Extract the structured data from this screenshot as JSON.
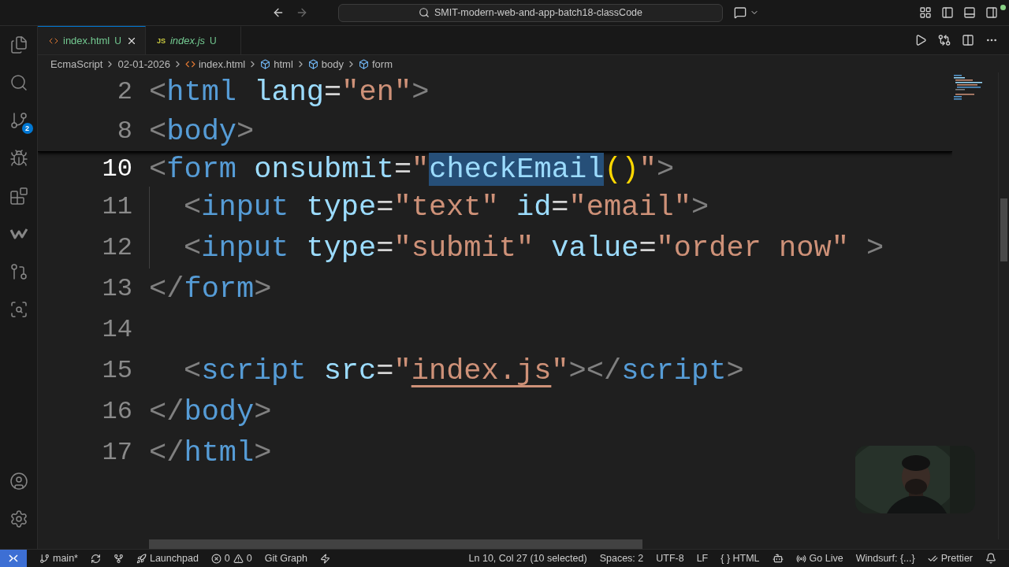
{
  "title_bar": {
    "search": "SMIT-modern-web-and-app-batch18-classCode"
  },
  "activity_bar": {
    "items": [
      {
        "kind": "explorer",
        "selected": false
      },
      {
        "kind": "search",
        "selected": false
      },
      {
        "kind": "source-control",
        "selected": false,
        "badge": "2"
      },
      {
        "kind": "run-debug",
        "selected": false
      },
      {
        "kind": "extensions",
        "selected": false
      },
      {
        "kind": "windsurf",
        "selected": false
      },
      {
        "kind": "git-graph",
        "selected": false
      },
      {
        "kind": "inspect",
        "selected": false
      }
    ],
    "bottom": [
      {
        "kind": "account"
      },
      {
        "kind": "settings"
      }
    ]
  },
  "tabs": [
    {
      "label": "index.html",
      "kind": "html",
      "status": "U",
      "selected": true,
      "preview": false
    },
    {
      "label": "index.js",
      "kind": "js",
      "icon_text": "JS",
      "status": "U",
      "selected": false,
      "preview": true
    }
  ],
  "breadcrumbs": [
    {
      "label": "EcmaScript",
      "kind": "folder"
    },
    {
      "label": "02-01-2026",
      "kind": "folder"
    },
    {
      "label": "index.html",
      "kind": "file"
    },
    {
      "label": "html",
      "kind": "element"
    },
    {
      "label": "body",
      "kind": "element"
    },
    {
      "label": "form",
      "kind": "element"
    }
  ],
  "editor": {
    "sticky_lines": [
      {
        "number": "2",
        "current": false,
        "tokens": [
          {
            "text": "<",
            "kind": "punct"
          },
          {
            "text": "html",
            "kind": "tag"
          },
          {
            "text": " lang",
            "kind": "attr"
          },
          {
            "text": "=",
            "kind": "eq"
          },
          {
            "text": "\"en\"",
            "kind": "string"
          },
          {
            "text": ">",
            "kind": "punct"
          }
        ]
      },
      {
        "number": "8",
        "current": false,
        "tokens": [
          {
            "text": "<",
            "kind": "punct"
          },
          {
            "text": "body",
            "kind": "tag"
          },
          {
            "text": ">",
            "kind": "punct"
          }
        ]
      }
    ],
    "lines": [
      {
        "number": "10",
        "current": true,
        "tokens": [
          {
            "text": "<",
            "kind": "punct"
          },
          {
            "text": "form",
            "kind": "tag"
          },
          {
            "text": " onsubmit",
            "kind": "attr"
          },
          {
            "text": "=",
            "kind": "eq"
          },
          {
            "text": "\"",
            "kind": "string"
          },
          {
            "text": "checkEmail",
            "kind": "func",
            "selected": true
          },
          {
            "text": "()",
            "kind": "paren"
          },
          {
            "text": "\"",
            "kind": "string"
          },
          {
            "text": ">",
            "kind": "punct"
          }
        ]
      },
      {
        "number": "11",
        "current": false,
        "indented": true,
        "guide": true,
        "tokens": [
          {
            "text": "<",
            "kind": "punct"
          },
          {
            "text": "input",
            "kind": "tag"
          },
          {
            "text": " type",
            "kind": "attr"
          },
          {
            "text": "=",
            "kind": "eq"
          },
          {
            "text": "\"text\"",
            "kind": "string"
          },
          {
            "text": " id",
            "kind": "attr"
          },
          {
            "text": "=",
            "kind": "eq"
          },
          {
            "text": "\"email\"",
            "kind": "string"
          },
          {
            "text": ">",
            "kind": "punct"
          }
        ]
      },
      {
        "number": "12",
        "current": false,
        "indented": true,
        "guide": true,
        "tokens": [
          {
            "text": "<",
            "kind": "punct"
          },
          {
            "text": "input",
            "kind": "tag"
          },
          {
            "text": " type",
            "kind": "attr"
          },
          {
            "text": "=",
            "kind": "eq"
          },
          {
            "text": "\"submit\"",
            "kind": "string"
          },
          {
            "text": " value",
            "kind": "attr"
          },
          {
            "text": "=",
            "kind": "eq"
          },
          {
            "text": "\"order now\"",
            "kind": "string"
          },
          {
            "text": " >",
            "kind": "punct"
          }
        ]
      },
      {
        "number": "13",
        "current": false,
        "tokens": [
          {
            "text": "</",
            "kind": "punct"
          },
          {
            "text": "form",
            "kind": "tag"
          },
          {
            "text": ">",
            "kind": "punct"
          }
        ]
      },
      {
        "number": "14",
        "current": false
      },
      {
        "number": "15",
        "current": false,
        "indented": true,
        "guide": false,
        "tokens": [
          {
            "text": "<",
            "kind": "punct"
          },
          {
            "text": "script",
            "kind": "tag"
          },
          {
            "text": " src",
            "kind": "attr"
          },
          {
            "text": "=",
            "kind": "eq"
          },
          {
            "text": "\"",
            "kind": "string"
          },
          {
            "text": "index.js",
            "kind": "string",
            "underlined": true
          },
          {
            "text": "\"",
            "kind": "string"
          },
          {
            "text": "></",
            "kind": "punct"
          },
          {
            "text": "script",
            "kind": "tag"
          },
          {
            "text": ">",
            "kind": "punct"
          }
        ]
      },
      {
        "number": "16",
        "current": false,
        "tokens": [
          {
            "text": "</",
            "kind": "punct"
          },
          {
            "text": "body",
            "kind": "tag"
          },
          {
            "text": ">",
            "kind": "punct"
          }
        ]
      },
      {
        "number": "17",
        "current": false,
        "tokens": [
          {
            "text": "</",
            "kind": "punct"
          },
          {
            "text": "html",
            "kind": "tag"
          },
          {
            "text": ">",
            "kind": "punct"
          }
        ]
      }
    ]
  },
  "status_bar": {
    "left": [
      {
        "kind": "branch",
        "label": "main*"
      },
      {
        "kind": "sync"
      },
      {
        "kind": "flow"
      },
      {
        "kind": "launchpad",
        "label": "Launchpad"
      },
      {
        "kind": "problems",
        "errors": "0",
        "warnings": "0"
      },
      {
        "kind": "text",
        "label": "Git Graph"
      },
      {
        "kind": "bolt"
      }
    ],
    "right": [
      {
        "kind": "text",
        "label": "Ln 10, Col 27 (10 selected)"
      },
      {
        "kind": "text",
        "label": "Spaces: 2"
      },
      {
        "kind": "text",
        "label": "UTF-8"
      },
      {
        "kind": "text",
        "label": "LF"
      },
      {
        "kind": "language",
        "glyph": "{ }",
        "label": "HTML"
      },
      {
        "kind": "copilot"
      },
      {
        "kind": "golive",
        "label": "Go Live"
      },
      {
        "kind": "text",
        "label": "Windsurf: {...}"
      },
      {
        "kind": "prettier",
        "label": "Prettier"
      },
      {
        "kind": "bell"
      }
    ]
  }
}
